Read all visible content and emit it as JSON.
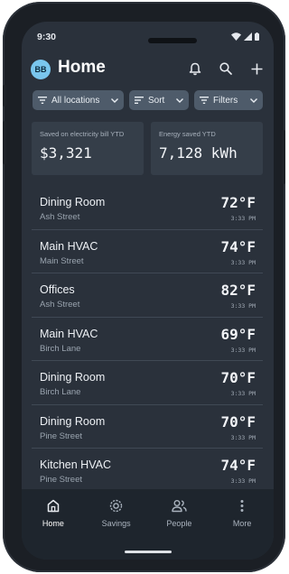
{
  "status": {
    "time": "9:30"
  },
  "header": {
    "avatar_initials": "BB",
    "title": "Home"
  },
  "header_actions": [
    {
      "icon": "bell-icon"
    },
    {
      "icon": "search-icon"
    },
    {
      "icon": "plus-icon"
    }
  ],
  "filters": {
    "locations_label": "All locations",
    "sort_label": "Sort",
    "filters_label": "Filters"
  },
  "summary": {
    "saved_label": "Saved on electricity bill YTD",
    "saved_value": "$3,321",
    "energy_label": "Energy saved YTD",
    "energy_value": "7,128 kWh"
  },
  "rooms": [
    {
      "name": "Dining Room",
      "street": "Ash Street",
      "temp": "72°F",
      "time": "3:33 PM"
    },
    {
      "name": "Main HVAC",
      "street": "Main Street",
      "temp": "74°F",
      "time": "3:33 PM"
    },
    {
      "name": "Offices",
      "street": "Ash Street",
      "temp": "82°F",
      "time": "3:33 PM"
    },
    {
      "name": "Main HVAC",
      "street": "Birch Lane",
      "temp": "69°F",
      "time": "3:33 PM"
    },
    {
      "name": "Dining Room",
      "street": "Birch Lane",
      "temp": "70°F",
      "time": "3:33 PM"
    },
    {
      "name": "Dining Room",
      "street": "Pine Street",
      "temp": "70°F",
      "time": "3:33 PM"
    },
    {
      "name": "Kitchen HVAC",
      "street": "Pine Street",
      "temp": "74°F",
      "time": "3:33 PM"
    }
  ],
  "nav": {
    "items": [
      {
        "label": "Home",
        "icon": "home-icon",
        "active": true
      },
      {
        "label": "Savings",
        "icon": "savings-icon",
        "active": false
      },
      {
        "label": "People",
        "icon": "people-icon",
        "active": false
      },
      {
        "label": "More",
        "icon": "more-vertical-icon",
        "active": false
      }
    ]
  },
  "colors": {
    "screen_bg": "#2a313b",
    "card_bg": "#353e49",
    "chip_bg": "#4e5b6a",
    "avatar": "#79c6ee",
    "nav_bg": "#1e252d"
  }
}
